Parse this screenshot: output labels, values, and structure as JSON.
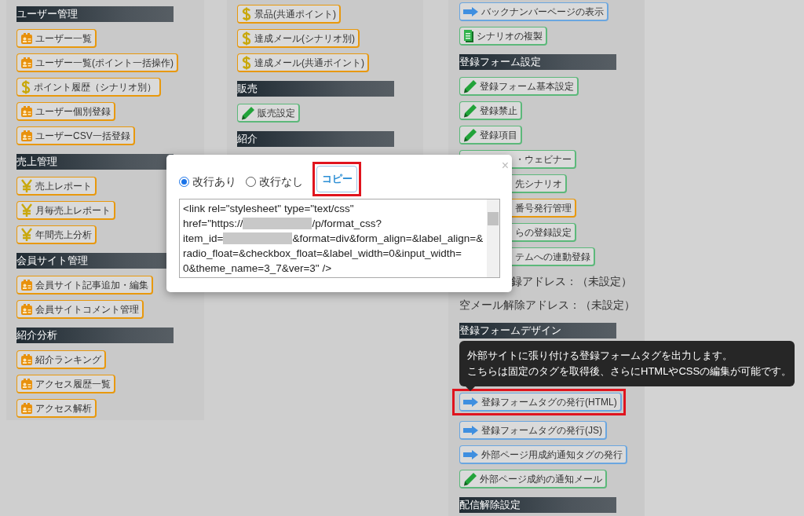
{
  "columns": [
    {
      "items": [
        {
          "kind": "header",
          "text": "ユーザー管理"
        },
        {
          "kind": "card",
          "color": "#e8980c",
          "text": "ユーザー一覧",
          "highlighted": false
        },
        {
          "kind": "card",
          "color": "#e8980c",
          "text": "ユーザー一覧(ポイント一括操作)",
          "highlighted": false
        },
        {
          "kind": "dollar",
          "color": "#e8980c",
          "text": "ポイント履歴（シナリオ別）",
          "highlighted": false
        },
        {
          "kind": "card",
          "color": "#e8980c",
          "text": "ユーザー個別登録",
          "highlighted": false
        },
        {
          "kind": "card",
          "color": "#e8980c",
          "text": "ユーザーCSV一括登録",
          "highlighted": false
        },
        {
          "kind": "header",
          "text": "売上管理"
        },
        {
          "kind": "yen",
          "color": "#e8980c",
          "text": "売上レポート",
          "highlighted": false
        },
        {
          "kind": "yen",
          "color": "#e8980c",
          "text": "月毎売上レポート",
          "highlighted": false
        },
        {
          "kind": "yen",
          "color": "#e8980c",
          "text": "年間売上分析",
          "highlighted": false
        },
        {
          "kind": "header",
          "text": "会員サイト管理"
        },
        {
          "kind": "card",
          "color": "#e8980c",
          "text": "会員サイト記事追加・編集",
          "highlighted": false
        },
        {
          "kind": "card",
          "color": "#e8980c",
          "text": "会員サイトコメント管理",
          "highlighted": false
        },
        {
          "kind": "header",
          "text": "紹介分析"
        },
        {
          "kind": "card",
          "color": "#e8980c",
          "text": "紹介ランキング",
          "highlighted": false
        },
        {
          "kind": "card",
          "color": "#e8980c",
          "text": "アクセス履歴一覧",
          "highlighted": false
        },
        {
          "kind": "card",
          "color": "#e8980c",
          "text": "アクセス解析",
          "highlighted": false
        }
      ]
    },
    {
      "items": [
        {
          "kind": "dollar",
          "color": "#e8980c",
          "text": "景品(共通ポイント)",
          "highlighted": false
        },
        {
          "kind": "dollar",
          "color": "#e8980c",
          "text": "達成メール(シナリオ別)",
          "highlighted": false
        },
        {
          "kind": "dollar",
          "color": "#e8980c",
          "text": "達成メール(共通ポイント)",
          "highlighted": false
        },
        {
          "kind": "header",
          "text": "販売"
        },
        {
          "kind": "pencil",
          "color": "#5cb87a",
          "text": "販売設定",
          "highlighted": false
        },
        {
          "kind": "header",
          "text": "紹介"
        }
      ]
    },
    {
      "items": [
        {
          "kind": "arrow",
          "color": "#6aa6e0",
          "text": "バックナンバーページの表示",
          "highlighted": false
        },
        {
          "kind": "doc",
          "color": "#5cb87a",
          "text": "シナリオの複製",
          "highlighted": false
        },
        {
          "kind": "header",
          "text": "登録フォーム設定"
        },
        {
          "kind": "pencil",
          "color": "#5cb87a",
          "text": "登録フォーム基本設定",
          "highlighted": false
        },
        {
          "kind": "pencil",
          "color": "#5cb87a",
          "text": "登録禁止",
          "highlighted": false
        },
        {
          "kind": "pencil",
          "color": "#5cb87a",
          "text": "登録項目",
          "highlighted": false
        },
        {
          "kind": "partial-button",
          "color": "#5cb87a",
          "text": "・ウェビナー"
        },
        {
          "kind": "partial-button",
          "color": "#5cb87a",
          "text": "先シナリオ"
        },
        {
          "kind": "partial-button",
          "color": "#e8980c",
          "text": "番号発行管理"
        },
        {
          "kind": "partial-button",
          "color": "#5cb87a",
          "text": "らの登録設定"
        },
        {
          "kind": "partial-button",
          "color": "#5cb87a",
          "text": "テムへの連動登録"
        },
        {
          "kind": "partial-text",
          "text": "録アドレス：（未設定）"
        },
        {
          "kind": "text",
          "text": "空メール解除アドレス：（未設定）"
        },
        {
          "kind": "header",
          "text": "登録フォームデザイン"
        },
        {
          "kind": "tooltip",
          "lines": [
            "外部サイトに張り付ける登録フォームタグを出力します。",
            "こちらは固定のタグを取得後、さらにHTMLやCSSの編集が可能です。"
          ]
        },
        {
          "kind": "arrow",
          "color": "#6aa6e0",
          "text": "登録フォームタグの発行(HTML)",
          "highlighted": true
        },
        {
          "kind": "arrow",
          "color": "#6aa6e0",
          "text": "登録フォームタグの発行(JS)",
          "highlighted": false
        },
        {
          "kind": "arrow",
          "color": "#6aa6e0",
          "text": "外部ページ用成約通知タグの発行",
          "highlighted": false
        },
        {
          "kind": "pencil",
          "color": "#5cb87a",
          "text": "外部ページ成約の通知メール",
          "highlighted": false
        },
        {
          "kind": "header",
          "text": "配信解除設定"
        }
      ]
    }
  ],
  "dialog": {
    "close": "×",
    "radios": [
      {
        "label": "改行あり",
        "selected": true
      },
      {
        "label": "改行なし",
        "selected": false
      }
    ],
    "copy_button": {
      "label": "コピー",
      "highlighted": true
    },
    "code_lines": [
      [
        {
          "kind": "text",
          "text": "<link rel=\"stylesheet\" type=\"text/css\""
        }
      ],
      [
        {
          "kind": "text",
          "text": "href=\"https://"
        },
        {
          "kind": "redacted"
        },
        {
          "kind": "text",
          "text": "/p/format_css?"
        }
      ],
      [
        {
          "kind": "text",
          "text": "item_id="
        },
        {
          "kind": "redacted"
        },
        {
          "kind": "text",
          "text": "&format=div&form_align=&label_align=&"
        }
      ],
      [
        {
          "kind": "text",
          "text": "radio_float=&checkbox_float=&label_width=0&input_width="
        }
      ],
      [
        {
          "kind": "text",
          "text": "0&theme_name=3_7&ver=3\" />"
        }
      ]
    ]
  }
}
